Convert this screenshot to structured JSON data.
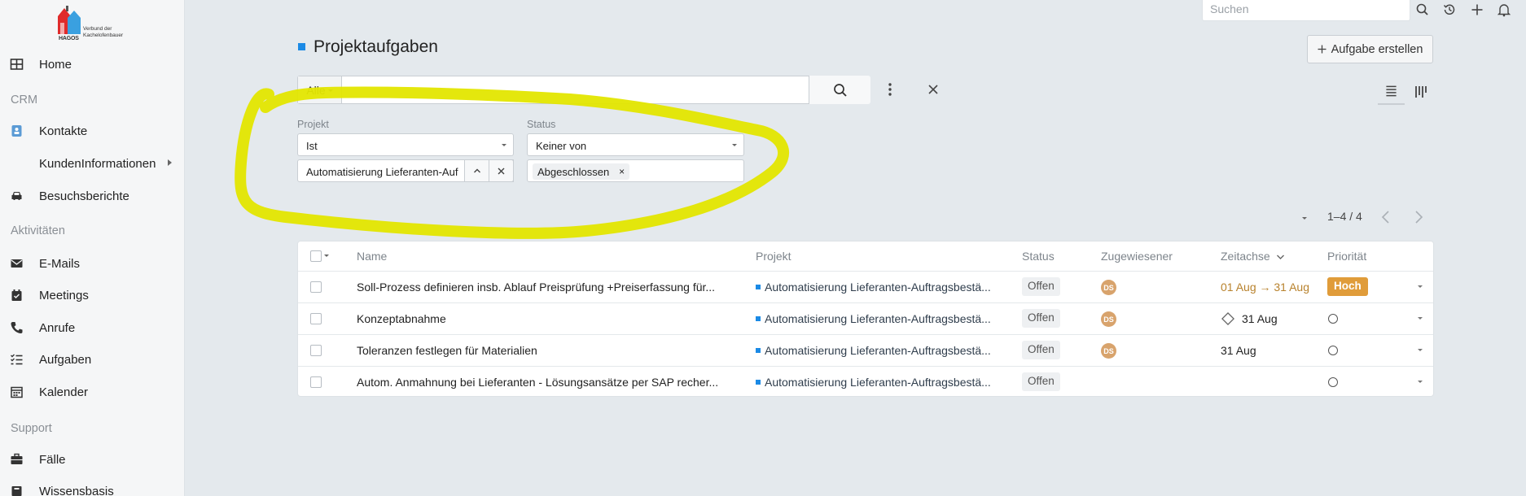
{
  "app": {
    "logo_text": "Verbund der Kachelofenbauer",
    "logo_brand": "HAGOS"
  },
  "sidebar": {
    "items": [
      {
        "label": "Home",
        "icon": "grid-icon"
      },
      {
        "label": "Kontakte",
        "icon": "contact-card-icon"
      },
      {
        "label": "KundenInformationen",
        "icon": ""
      },
      {
        "label": "Besuchsberichte",
        "icon": "car-icon"
      },
      {
        "label": "E-Mails",
        "icon": "envelope-icon"
      },
      {
        "label": "Meetings",
        "icon": "calendar-check-icon"
      },
      {
        "label": "Anrufe",
        "icon": "phone-icon"
      },
      {
        "label": "Aufgaben",
        "icon": "task-list-icon"
      },
      {
        "label": "Kalender",
        "icon": "calendar-icon"
      },
      {
        "label": "Fälle",
        "icon": "briefcase-icon"
      },
      {
        "label": "Wissensbasis",
        "icon": "book-icon"
      }
    ],
    "sections": {
      "crm": "CRM",
      "activities": "Aktivitäten",
      "support": "Support"
    }
  },
  "topbar": {
    "search_placeholder": "Suchen"
  },
  "header": {
    "title": "Projektaufgaben",
    "create_label": "Aufgabe erstellen"
  },
  "search": {
    "scope": "Alle",
    "value": ""
  },
  "filters": {
    "project_label": "Projekt",
    "project_operator": "Ist",
    "project_value": "Automatisierung Lieferanten-Auf",
    "status_label": "Status",
    "status_operator": "Keiner von",
    "status_tag": "Abgeschlossen",
    "tag_remove": "×"
  },
  "pagination": {
    "range": "1–4 / 4"
  },
  "table": {
    "columns": {
      "name": "Name",
      "project": "Projekt",
      "status": "Status",
      "assignee": "Zugewiesener",
      "timeline": "Zeitachse",
      "priority": "Priorität"
    },
    "rows": [
      {
        "name": "Soll-Prozess definieren insb. Ablauf Preisprüfung +Preiserfassung für...",
        "project": "Automatisierung Lieferanten-Auftragsbestä...",
        "status": "Offen",
        "assignee": "DS",
        "date_start": "01 Aug",
        "date_end": "31 Aug",
        "priority": "Hoch"
      },
      {
        "name": "Konzeptabnahme",
        "project": "Automatisierung Lieferanten-Auftragsbestä...",
        "status": "Offen",
        "assignee": "DS",
        "date": "31 Aug",
        "priority": ""
      },
      {
        "name": "Toleranzen festlegen für Materialien",
        "project": "Automatisierung Lieferanten-Auftragsbestä...",
        "status": "Offen",
        "assignee": "DS",
        "date": "31 Aug",
        "priority": ""
      },
      {
        "name": "Autom. Anmahnung bei Lieferanten - Lösungsansätze per SAP recher...",
        "project": "Automatisierung Lieferanten-Auftragsbestä...",
        "status": "Offen",
        "assignee": "",
        "date": "",
        "priority": ""
      }
    ]
  },
  "colors": {
    "accent": "#1b8ae5",
    "highlight": "#e3e600",
    "priority_high": "#e09c3a",
    "avatar": "#d8a36c"
  }
}
